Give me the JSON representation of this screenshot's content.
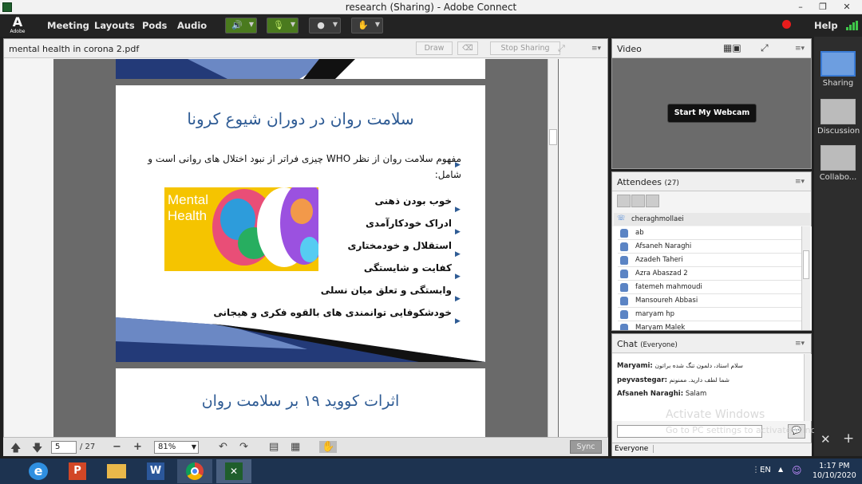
{
  "window": {
    "title": "research (Sharing) - Adobe Connect",
    "min": "–",
    "restore": "❐",
    "close": "✕"
  },
  "menubar": {
    "logo": "A",
    "logo_text": "Adobe",
    "items": [
      "Meeting",
      "Layouts",
      "Pods",
      "Audio"
    ],
    "help": "Help"
  },
  "share_pod": {
    "title": "mental health in corona 2.pdf",
    "draw_label": "Draw",
    "stop_sharing_label": "Stop Sharing",
    "slide1": {
      "heading": "سلامت روان در دوران شیوع کرونا",
      "intro_line1": "مفهوم سلامت روان از نظر WHO چیزی فراتر از نبود اختلال های روانی است و",
      "intro_line2": "شامل:",
      "bullets": [
        "خوب بودن ذهنی",
        "ادراک خودکارآمدی",
        "استقلال و خودمختاری",
        "کفایت و شایستگی",
        "وابستگی و تعلق میان نسلی",
        "خودشکوفایی توانمندی های بالقوه فکری و هیجانی"
      ],
      "image_text": "Mental Health"
    },
    "slide2": {
      "heading": "اثرات کووید ۱۹ بر سلامت روان"
    },
    "page_current": "5",
    "page_total": "/ 27",
    "zoom": "81%",
    "sync_label": "Sync"
  },
  "video_pod": {
    "title": "Video",
    "start_webcam": "Start My Webcam"
  },
  "attendees_pod": {
    "title": "Attendees",
    "count": "(27)",
    "host": "cheraghmollaei",
    "list": [
      "ab",
      "Afsaneh Naraghi",
      "Azadeh Taheri",
      "Azra Abaszad 2",
      "fatemeh mahmoudi",
      "Mansoureh Abbasi",
      "maryam hp",
      "Maryam Malek"
    ]
  },
  "chat_pod": {
    "title": "Chat",
    "scope": "(Everyone)",
    "messages": [
      {
        "sender": "Maryami:",
        "text": "سلام استاد، دلمون تنگ شده براتون"
      },
      {
        "sender": "peyvastegar:",
        "text": "شما لطف دارید. ممنونم"
      },
      {
        "sender": "Afsaneh Naraghi:",
        "text": "Salam"
      }
    ],
    "watermark_title": "Activate Windows",
    "watermark_sub": "Go to PC settings to activate Windows.",
    "recipient": "Everyone"
  },
  "rail": [
    {
      "label": "Sharing"
    },
    {
      "label": "Discussion"
    },
    {
      "label": "Collabo..."
    }
  ],
  "taskbar": {
    "lang": "EN",
    "time": "1:17 PM",
    "date": "10/10/2020"
  },
  "colors": {
    "accent": "#3a7bd5",
    "slide_heading": "#2e5b94",
    "menubar": "#232323",
    "taskbar": "#1d3350"
  }
}
